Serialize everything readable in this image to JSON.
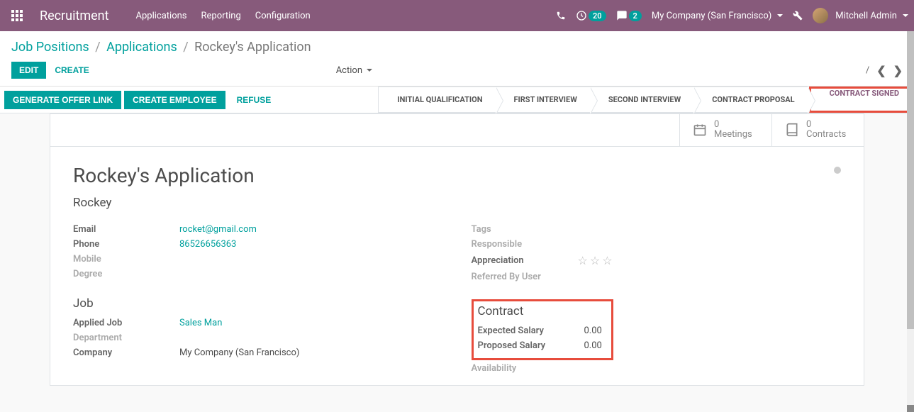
{
  "topbar": {
    "app_title": "Recruitment",
    "nav": {
      "applications": "Applications",
      "reporting": "Reporting",
      "configuration": "Configuration"
    },
    "activity_count": "20",
    "msg_count": "2",
    "company": "My Company (San Francisco)",
    "user": "Mitchell Admin"
  },
  "breadcrumb": {
    "job_positions": "Job Positions",
    "applications": "Applications",
    "current": "Rockey's Application"
  },
  "actionbar": {
    "edit": "Edit",
    "create": "Create",
    "action": "Action",
    "pager_sep": "/"
  },
  "stagebar": {
    "generate_offer": "Generate Offer Link",
    "create_employee": "Create Employee",
    "refuse": "Refuse",
    "stages": {
      "s1": "Initial Qualification",
      "s2": "First Interview",
      "s3": "Second Interview",
      "s4": "Contract Proposal",
      "s5": "Contract Signed"
    }
  },
  "stats": {
    "meetings_count": "0",
    "meetings_label": "Meetings",
    "contracts_count": "0",
    "contracts_label": "Contracts"
  },
  "record": {
    "title": "Rockey's Application",
    "name": "Rockey"
  },
  "left_fields": {
    "email_label": "Email",
    "email_value": "rocket@gmail.com",
    "phone_label": "Phone",
    "phone_value": "86526656363",
    "mobile_label": "Mobile",
    "degree_label": "Degree"
  },
  "right_fields": {
    "tags_label": "Tags",
    "responsible_label": "Responsible",
    "appreciation_label": "Appreciation",
    "referred_label": "Referred By User"
  },
  "job_section": {
    "title": "Job",
    "applied_job_label": "Applied Job",
    "applied_job_value": "Sales Man",
    "department_label": "Department",
    "company_label": "Company",
    "company_value": "My Company (San Francisco)"
  },
  "contract_section": {
    "title": "Contract",
    "expected_label": "Expected Salary",
    "expected_value": "0.00",
    "proposed_label": "Proposed Salary",
    "proposed_value": "0.00",
    "availability_label": "Availability"
  }
}
